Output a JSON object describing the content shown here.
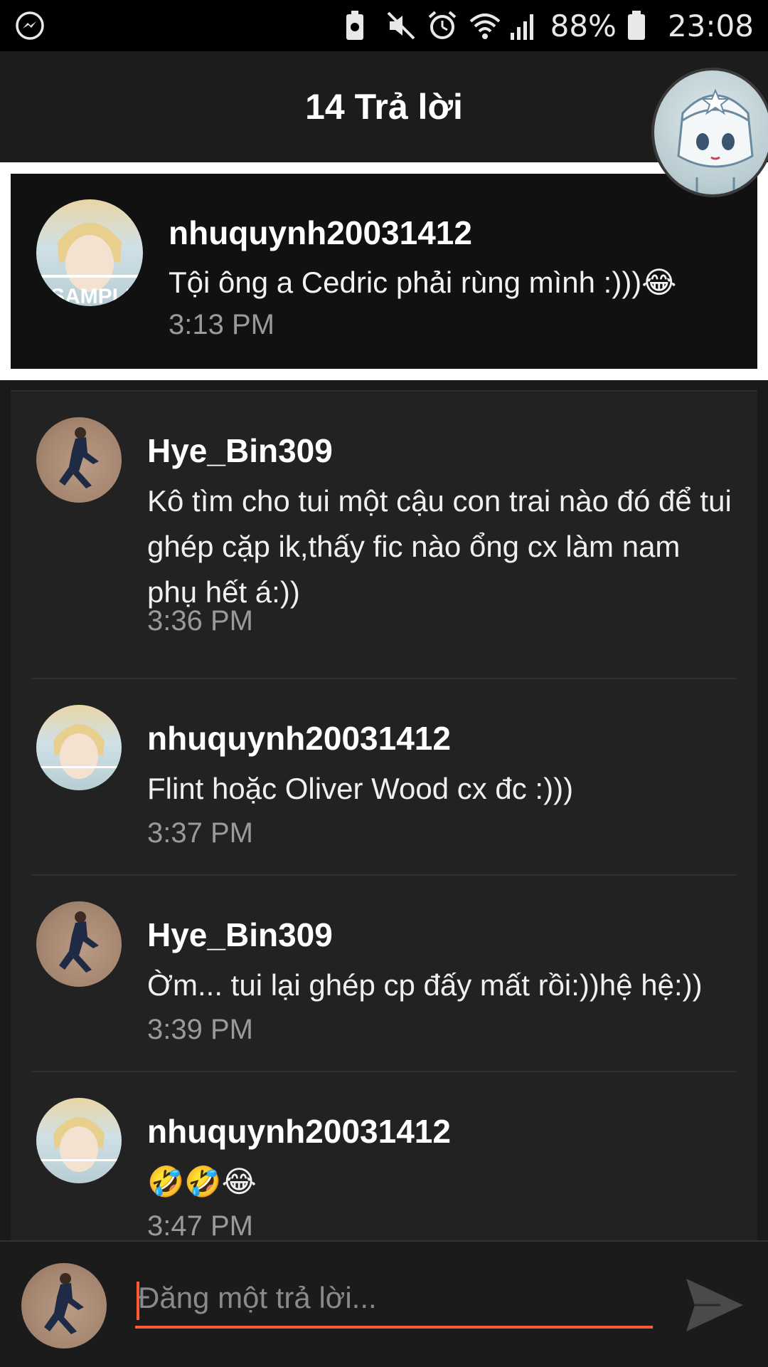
{
  "status_bar": {
    "battery_percent": "88%",
    "time": "23:08",
    "icons": [
      "messenger-icon",
      "battery-saver-icon",
      "mute-icon",
      "alarm-icon",
      "wifi-icon",
      "signal-icon",
      "battery-icon"
    ]
  },
  "header": {
    "title": "14 Trả lời"
  },
  "original_comment": {
    "username": "nhuquynh20031412",
    "text": "Tội ông a Cedric phải rùng mình :)))😂",
    "time": "3:13 PM",
    "avatar_badge": "SAMPLE"
  },
  "replies": [
    {
      "username": "Hye_Bin309",
      "text": "Kô tìm cho tui một cậu con trai nào đó để tui ghép cặp ik,thấy fic nào ổng cx làm nam phụ hết á:))",
      "time": "3:36 PM"
    },
    {
      "username": "nhuquynh20031412",
      "text": "Flint hoặc Oliver Wood cx đc :)))",
      "time": "3:37 PM"
    },
    {
      "username": "Hye_Bin309",
      "text": "Ờm... tui lại ghép cp đấy mất rồi:))hệ hệ:))",
      "time": "3:39 PM"
    },
    {
      "username": "nhuquynh20031412",
      "text": "🤣🤣😂",
      "time": "3:47 PM"
    }
  ],
  "input": {
    "placeholder": "Đăng một trả lời..."
  },
  "colors": {
    "accent": "#ff5a36",
    "background": "#1a1a1a",
    "card": "#222222"
  }
}
